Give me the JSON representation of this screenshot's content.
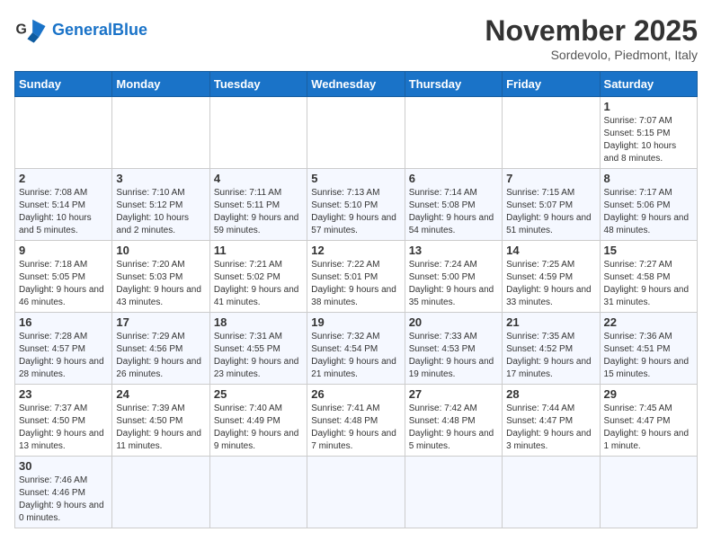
{
  "header": {
    "logo_general": "General",
    "logo_blue": "Blue",
    "month_title": "November 2025",
    "location": "Sordevolo, Piedmont, Italy"
  },
  "weekdays": [
    "Sunday",
    "Monday",
    "Tuesday",
    "Wednesday",
    "Thursday",
    "Friday",
    "Saturday"
  ],
  "weeks": [
    {
      "days": [
        {
          "num": "",
          "info": ""
        },
        {
          "num": "",
          "info": ""
        },
        {
          "num": "",
          "info": ""
        },
        {
          "num": "",
          "info": ""
        },
        {
          "num": "",
          "info": ""
        },
        {
          "num": "",
          "info": ""
        },
        {
          "num": "1",
          "info": "Sunrise: 7:07 AM\nSunset: 5:15 PM\nDaylight: 10 hours and 8 minutes."
        }
      ]
    },
    {
      "days": [
        {
          "num": "2",
          "info": "Sunrise: 7:08 AM\nSunset: 5:14 PM\nDaylight: 10 hours and 5 minutes."
        },
        {
          "num": "3",
          "info": "Sunrise: 7:10 AM\nSunset: 5:12 PM\nDaylight: 10 hours and 2 minutes."
        },
        {
          "num": "4",
          "info": "Sunrise: 7:11 AM\nSunset: 5:11 PM\nDaylight: 9 hours and 59 minutes."
        },
        {
          "num": "5",
          "info": "Sunrise: 7:13 AM\nSunset: 5:10 PM\nDaylight: 9 hours and 57 minutes."
        },
        {
          "num": "6",
          "info": "Sunrise: 7:14 AM\nSunset: 5:08 PM\nDaylight: 9 hours and 54 minutes."
        },
        {
          "num": "7",
          "info": "Sunrise: 7:15 AM\nSunset: 5:07 PM\nDaylight: 9 hours and 51 minutes."
        },
        {
          "num": "8",
          "info": "Sunrise: 7:17 AM\nSunset: 5:06 PM\nDaylight: 9 hours and 48 minutes."
        }
      ]
    },
    {
      "days": [
        {
          "num": "9",
          "info": "Sunrise: 7:18 AM\nSunset: 5:05 PM\nDaylight: 9 hours and 46 minutes."
        },
        {
          "num": "10",
          "info": "Sunrise: 7:20 AM\nSunset: 5:03 PM\nDaylight: 9 hours and 43 minutes."
        },
        {
          "num": "11",
          "info": "Sunrise: 7:21 AM\nSunset: 5:02 PM\nDaylight: 9 hours and 41 minutes."
        },
        {
          "num": "12",
          "info": "Sunrise: 7:22 AM\nSunset: 5:01 PM\nDaylight: 9 hours and 38 minutes."
        },
        {
          "num": "13",
          "info": "Sunrise: 7:24 AM\nSunset: 5:00 PM\nDaylight: 9 hours and 35 minutes."
        },
        {
          "num": "14",
          "info": "Sunrise: 7:25 AM\nSunset: 4:59 PM\nDaylight: 9 hours and 33 minutes."
        },
        {
          "num": "15",
          "info": "Sunrise: 7:27 AM\nSunset: 4:58 PM\nDaylight: 9 hours and 31 minutes."
        }
      ]
    },
    {
      "days": [
        {
          "num": "16",
          "info": "Sunrise: 7:28 AM\nSunset: 4:57 PM\nDaylight: 9 hours and 28 minutes."
        },
        {
          "num": "17",
          "info": "Sunrise: 7:29 AM\nSunset: 4:56 PM\nDaylight: 9 hours and 26 minutes."
        },
        {
          "num": "18",
          "info": "Sunrise: 7:31 AM\nSunset: 4:55 PM\nDaylight: 9 hours and 23 minutes."
        },
        {
          "num": "19",
          "info": "Sunrise: 7:32 AM\nSunset: 4:54 PM\nDaylight: 9 hours and 21 minutes."
        },
        {
          "num": "20",
          "info": "Sunrise: 7:33 AM\nSunset: 4:53 PM\nDaylight: 9 hours and 19 minutes."
        },
        {
          "num": "21",
          "info": "Sunrise: 7:35 AM\nSunset: 4:52 PM\nDaylight: 9 hours and 17 minutes."
        },
        {
          "num": "22",
          "info": "Sunrise: 7:36 AM\nSunset: 4:51 PM\nDaylight: 9 hours and 15 minutes."
        }
      ]
    },
    {
      "days": [
        {
          "num": "23",
          "info": "Sunrise: 7:37 AM\nSunset: 4:50 PM\nDaylight: 9 hours and 13 minutes."
        },
        {
          "num": "24",
          "info": "Sunrise: 7:39 AM\nSunset: 4:50 PM\nDaylight: 9 hours and 11 minutes."
        },
        {
          "num": "25",
          "info": "Sunrise: 7:40 AM\nSunset: 4:49 PM\nDaylight: 9 hours and 9 minutes."
        },
        {
          "num": "26",
          "info": "Sunrise: 7:41 AM\nSunset: 4:48 PM\nDaylight: 9 hours and 7 minutes."
        },
        {
          "num": "27",
          "info": "Sunrise: 7:42 AM\nSunset: 4:48 PM\nDaylight: 9 hours and 5 minutes."
        },
        {
          "num": "28",
          "info": "Sunrise: 7:44 AM\nSunset: 4:47 PM\nDaylight: 9 hours and 3 minutes."
        },
        {
          "num": "29",
          "info": "Sunrise: 7:45 AM\nSunset: 4:47 PM\nDaylight: 9 hours and 1 minute."
        }
      ]
    },
    {
      "days": [
        {
          "num": "30",
          "info": "Sunrise: 7:46 AM\nSunset: 4:46 PM\nDaylight: 9 hours and 0 minutes."
        },
        {
          "num": "",
          "info": ""
        },
        {
          "num": "",
          "info": ""
        },
        {
          "num": "",
          "info": ""
        },
        {
          "num": "",
          "info": ""
        },
        {
          "num": "",
          "info": ""
        },
        {
          "num": "",
          "info": ""
        }
      ]
    }
  ]
}
